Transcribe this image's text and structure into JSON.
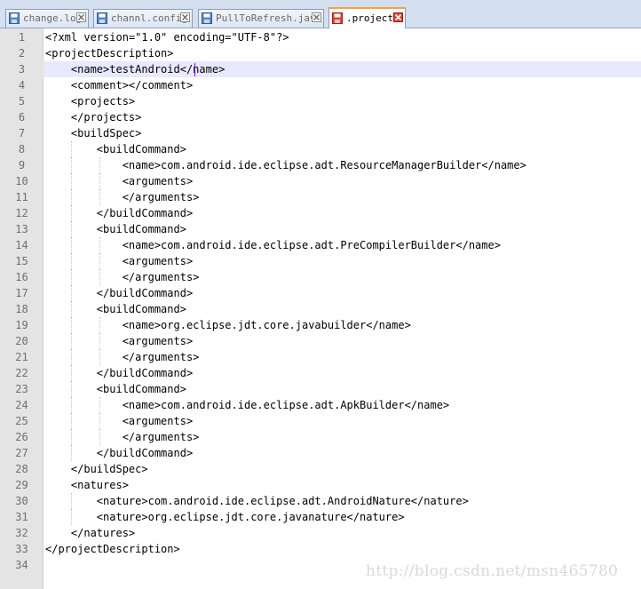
{
  "tabs": [
    {
      "label": "change.log",
      "icon": "saved-file-icon",
      "active": false
    },
    {
      "label": "channl.config",
      "icon": "saved-file-icon",
      "active": false
    },
    {
      "label": "PullToRefresh.java",
      "icon": "saved-file-icon",
      "active": false
    },
    {
      "label": ".project",
      "icon": "unsaved-file-icon",
      "active": true
    }
  ],
  "editor": {
    "current_line": 3,
    "lines": [
      {
        "num": "1",
        "text": "<?xml version=\"1.0\" encoding=\"UTF-8\"?>"
      },
      {
        "num": "2",
        "text": "<projectDescription>"
      },
      {
        "num": "3",
        "text": "    <name>testAndroid</name>"
      },
      {
        "num": "4",
        "text": "    <comment></comment>"
      },
      {
        "num": "5",
        "text": "    <projects>"
      },
      {
        "num": "6",
        "text": "    </projects>"
      },
      {
        "num": "7",
        "text": "    <buildSpec>"
      },
      {
        "num": "8",
        "text": "        <buildCommand>"
      },
      {
        "num": "9",
        "text": "            <name>com.android.ide.eclipse.adt.ResourceManagerBuilder</name>"
      },
      {
        "num": "10",
        "text": "            <arguments>"
      },
      {
        "num": "11",
        "text": "            </arguments>"
      },
      {
        "num": "12",
        "text": "        </buildCommand>"
      },
      {
        "num": "13",
        "text": "        <buildCommand>"
      },
      {
        "num": "14",
        "text": "            <name>com.android.ide.eclipse.adt.PreCompilerBuilder</name>"
      },
      {
        "num": "15",
        "text": "            <arguments>"
      },
      {
        "num": "16",
        "text": "            </arguments>"
      },
      {
        "num": "17",
        "text": "        </buildCommand>"
      },
      {
        "num": "18",
        "text": "        <buildCommand>"
      },
      {
        "num": "19",
        "text": "            <name>org.eclipse.jdt.core.javabuilder</name>"
      },
      {
        "num": "20",
        "text": "            <arguments>"
      },
      {
        "num": "21",
        "text": "            </arguments>"
      },
      {
        "num": "22",
        "text": "        </buildCommand>"
      },
      {
        "num": "23",
        "text": "        <buildCommand>"
      },
      {
        "num": "24",
        "text": "            <name>com.android.ide.eclipse.adt.ApkBuilder</name>"
      },
      {
        "num": "25",
        "text": "            <arguments>"
      },
      {
        "num": "26",
        "text": "            </arguments>"
      },
      {
        "num": "27",
        "text": "        </buildCommand>"
      },
      {
        "num": "28",
        "text": "    </buildSpec>"
      },
      {
        "num": "29",
        "text": "    <natures>"
      },
      {
        "num": "30",
        "text": "        <nature>com.android.ide.eclipse.adt.AndroidNature</nature>"
      },
      {
        "num": "31",
        "text": "        <nature>org.eclipse.jdt.core.javanature</nature>"
      },
      {
        "num": "32",
        "text": "    </natures>"
      },
      {
        "num": "33",
        "text": "</projectDescription>"
      },
      {
        "num": "34",
        "text": ""
      }
    ]
  },
  "watermark": "http://blog.csdn.net/msn465780",
  "colors": {
    "tab_active_accent": "#f3a23a",
    "current_line_bg": "#e8e8ff",
    "gutter_bg": "#e4e4e4",
    "caret": "#8000ff"
  }
}
